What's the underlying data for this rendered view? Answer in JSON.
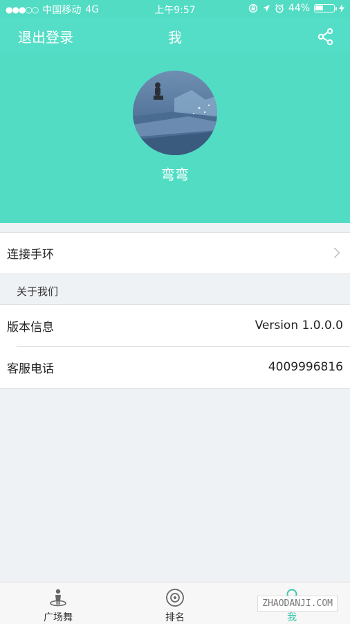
{
  "status_bar": {
    "signal_dots": "●●●○○",
    "carrier": "中国移动",
    "network": "4G",
    "time": "上午9:57",
    "battery_percent": "44%",
    "battery_level": 0.44,
    "icons": [
      "orientation-lock-icon",
      "location-icon",
      "alarm-icon",
      "charging-icon"
    ]
  },
  "nav": {
    "logout_label": "退出登录",
    "title": "我",
    "share_icon": "share-icon"
  },
  "profile": {
    "username": "弯弯",
    "header_color": "#52dcc4"
  },
  "rows": {
    "connect_band": "连接手环",
    "about_header": "关于我们",
    "version_label": "版本信息",
    "version_value": "Version 1.0.0.0",
    "service_label": "客服电话",
    "service_value": "4009996816"
  },
  "tabbar": {
    "tabs": [
      {
        "label": "广场舞",
        "icon": "dancer-icon"
      },
      {
        "label": "排名",
        "icon": "target-icon"
      },
      {
        "label": "我",
        "icon": "person-icon",
        "active": true
      }
    ],
    "active_color": "#3cc7ad"
  },
  "watermark": "ZHAODANJI.COM"
}
